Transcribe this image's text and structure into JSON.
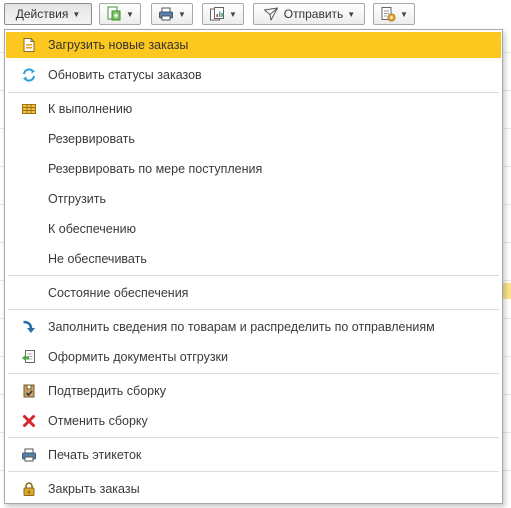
{
  "toolbar": {
    "actions_label": "Действия",
    "send_label": "Отправить"
  },
  "menu": {
    "items": [
      {
        "label": "Загрузить новые заказы",
        "icon": "document-load-icon"
      },
      {
        "label": "Обновить статусы заказов",
        "icon": "refresh-icon"
      },
      {
        "label": "К выполнению",
        "icon": "grid-table-icon"
      },
      {
        "label": "Резервировать",
        "icon": ""
      },
      {
        "label": "Резервировать по мере поступления",
        "icon": ""
      },
      {
        "label": "Отгрузить",
        "icon": ""
      },
      {
        "label": "К обеспечению",
        "icon": ""
      },
      {
        "label": "Не обеспечивать",
        "icon": ""
      },
      {
        "label": "Состояние обеспечения",
        "icon": ""
      },
      {
        "label": "Заполнить сведения по товарам и распределить по отправлениям",
        "icon": "arrow-down-right-icon"
      },
      {
        "label": "Оформить документы отгрузки",
        "icon": "document-arrow-icon"
      },
      {
        "label": "Подтвердить сборку",
        "icon": "package-icon"
      },
      {
        "label": "Отменить сборку",
        "icon": "red-x-icon"
      },
      {
        "label": "Печать этикеток",
        "icon": "printer-icon"
      },
      {
        "label": "Закрыть заказы",
        "icon": "lock-icon"
      }
    ]
  },
  "colors": {
    "highlight": "#fcc820",
    "cancel_red": "#d9262b",
    "refresh_blue": "#2a9fd6",
    "arrow_blue": "#2b6ea8",
    "lock_gold": "#d9a82b"
  }
}
